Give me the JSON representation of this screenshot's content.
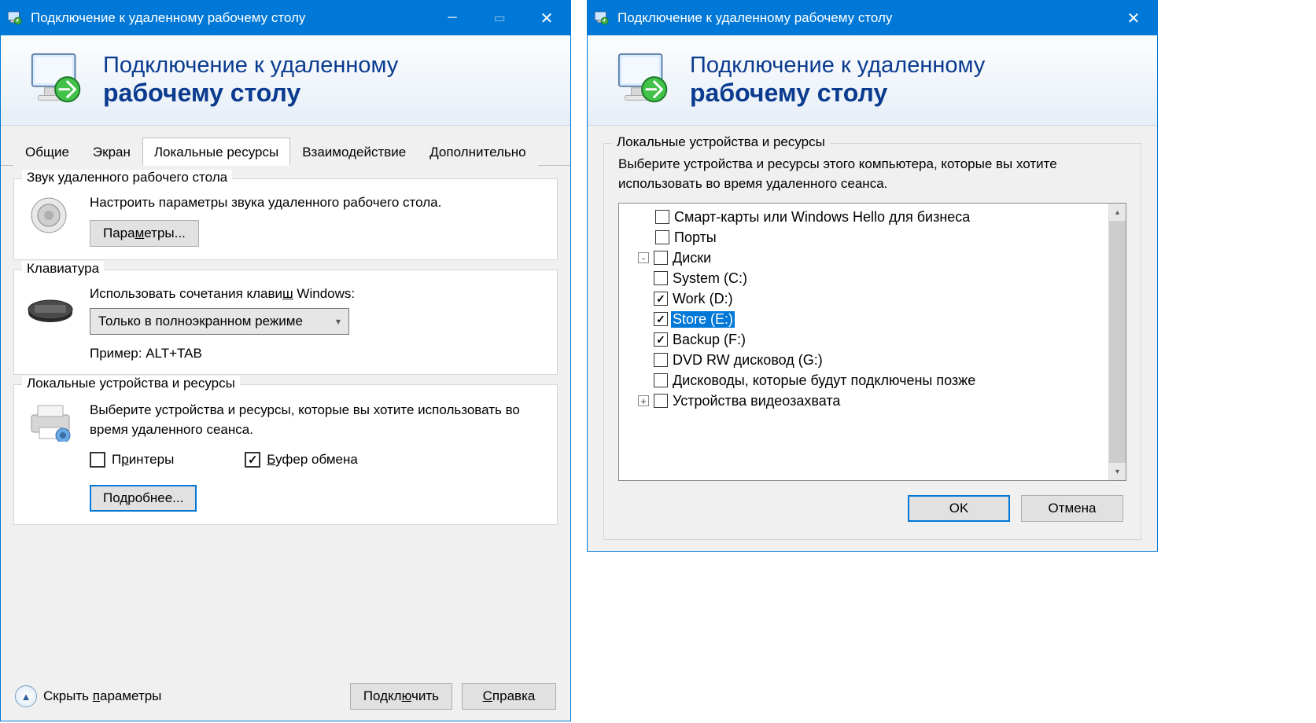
{
  "left": {
    "title": "Подключение к удаленному рабочему столу",
    "banner": {
      "line1": "Подключение к удаленному",
      "line2": "рабочему столу"
    },
    "tabs": [
      "Общие",
      "Экран",
      "Локальные ресурсы",
      "Взаимодействие",
      "Дополнительно"
    ],
    "active_tab": "Локальные ресурсы",
    "g_audio": {
      "title": "Звук удаленного рабочего стола",
      "desc": "Настроить параметры звука удаленного рабочего стола.",
      "btn": "Параметры...",
      "btn_hotkey": "м"
    },
    "g_keyboard": {
      "title": "Клавиатура",
      "desc": "Использовать сочетания клавиш Windows:",
      "hotkey": "ш",
      "dropdown": "Только в полноэкранном режиме",
      "example": "Пример: ALT+TAB"
    },
    "g_local": {
      "title": "Локальные устройства и ресурсы",
      "desc": "Выберите устройства и ресурсы, которые вы хотите использовать во время удаленного сеанса.",
      "cb1": "Принтеры",
      "cb1_hotkey": "р",
      "cb1_checked": false,
      "cb2": "Буфер обмена",
      "cb2_hotkey": "Б",
      "cb2_checked": true,
      "btn": "Подробнее...",
      "btn_hotkey": "д"
    },
    "footer": {
      "hide": "Скрыть параметры",
      "hide_hotkey": "п",
      "connect": "Подключить",
      "connect_hotkey": "ю",
      "help": "Справка",
      "help_hotkey": "С"
    }
  },
  "right": {
    "title": "Подключение к удаленному рабочему столу",
    "banner": {
      "line1": "Подключение к удаленному",
      "line2": "рабочему столу"
    },
    "group_title": "Локальные устройства и ресурсы",
    "desc": "Выберите устройства и ресурсы этого компьютера, которые вы хотите использовать во время удаленного сеанса.",
    "tree": [
      {
        "label": "Смарт-карты или Windows Hello для бизнеса",
        "checked": false,
        "depth": 0
      },
      {
        "label": "Порты",
        "checked": false,
        "depth": 0
      },
      {
        "label": "Диски",
        "checked": false,
        "depth": 0,
        "expander": "-"
      },
      {
        "label": "System (C:)",
        "checked": false,
        "depth": 1
      },
      {
        "label": "Work (D:)",
        "checked": true,
        "depth": 1
      },
      {
        "label": "Store (E:)",
        "checked": true,
        "depth": 1,
        "selected": true
      },
      {
        "label": "Backup (F:)",
        "checked": true,
        "depth": 1
      },
      {
        "label": "DVD RW дисковод (G:)",
        "checked": false,
        "depth": 1
      },
      {
        "label": "Дисководы, которые будут подключены позже",
        "checked": false,
        "depth": 1
      },
      {
        "label": "Устройства видеозахвата",
        "checked": false,
        "depth": 0,
        "expander": "+"
      }
    ],
    "ok": "OK",
    "cancel": "Отмена"
  }
}
